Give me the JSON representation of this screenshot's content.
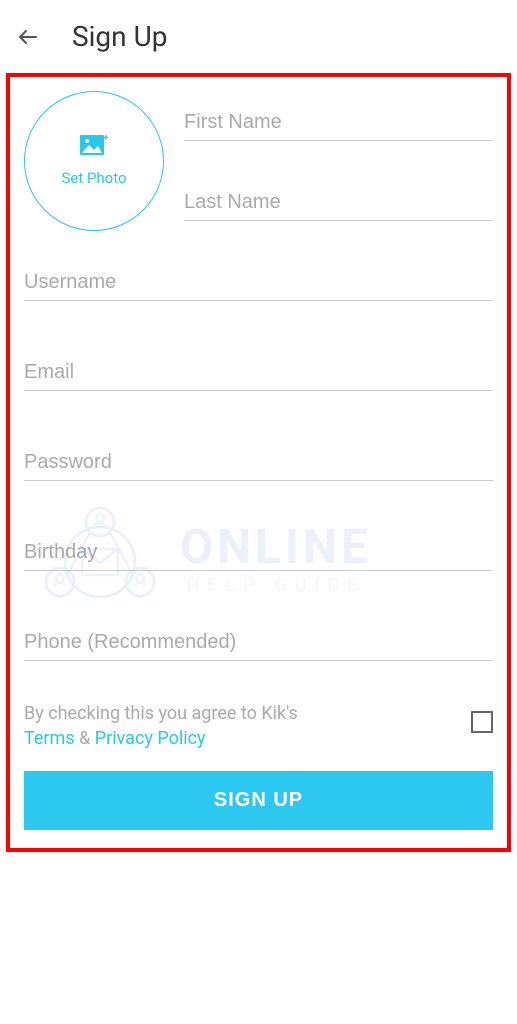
{
  "header": {
    "title": "Sign Up"
  },
  "photo": {
    "label": "Set Photo"
  },
  "fields": {
    "firstName": "First Name",
    "lastName": "Last Name",
    "username": "Username",
    "email": "Email",
    "password": "Password",
    "birthday": "Birthday",
    "phone": "Phone (Recommended)"
  },
  "agreement": {
    "prefix": "By checking this you agree to Kik's",
    "termsLabel": "Terms",
    "separator": " & ",
    "privacyLabel": "Privacy Policy"
  },
  "signup": {
    "button": "SIGN UP"
  },
  "watermark": {
    "main": "ONLINE",
    "sub": "HELP GUIDE"
  }
}
